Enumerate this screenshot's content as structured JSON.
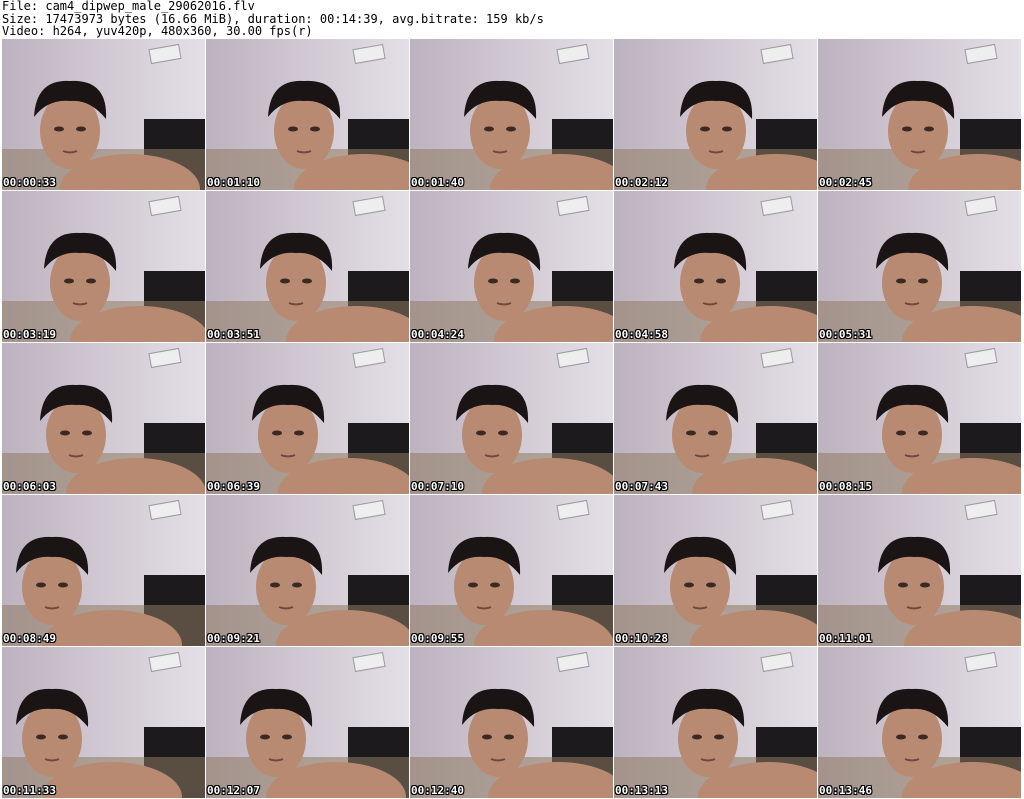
{
  "header": {
    "line1": "File: cam4_dipwep_male_29062016.flv",
    "line2": "Size: 17473973 bytes (16.66 MiB), duration: 00:14:39, avg.bitrate: 159 kb/s",
    "line3": "Video: h264, yuv420p, 480x360, 30.00 fps(r)"
  },
  "thumbnails": [
    {
      "time": "00:00:33"
    },
    {
      "time": "00:01:10"
    },
    {
      "time": "00:01:40"
    },
    {
      "time": "00:02:12"
    },
    {
      "time": "00:02:45"
    },
    {
      "time": "00:03:19"
    },
    {
      "time": "00:03:51"
    },
    {
      "time": "00:04:24"
    },
    {
      "time": "00:04:58"
    },
    {
      "time": "00:05:31"
    },
    {
      "time": "00:06:03"
    },
    {
      "time": "00:06:39"
    },
    {
      "time": "00:07:10"
    },
    {
      "time": "00:07:43"
    },
    {
      "time": "00:08:15"
    },
    {
      "time": "00:08:49"
    },
    {
      "time": "00:09:21"
    },
    {
      "time": "00:09:55"
    },
    {
      "time": "00:10:28"
    },
    {
      "time": "00:11:01"
    },
    {
      "time": "00:11:33"
    },
    {
      "time": "00:12:07"
    },
    {
      "time": "00:12:40"
    },
    {
      "time": "00:13:13"
    },
    {
      "time": "00:13:46"
    }
  ],
  "colors": {
    "wall": "#cbc3cf",
    "headboard": "#1c1a1c",
    "skin": "#b98a72",
    "hair": "#1a1414",
    "pillow": "#8e7a63"
  }
}
